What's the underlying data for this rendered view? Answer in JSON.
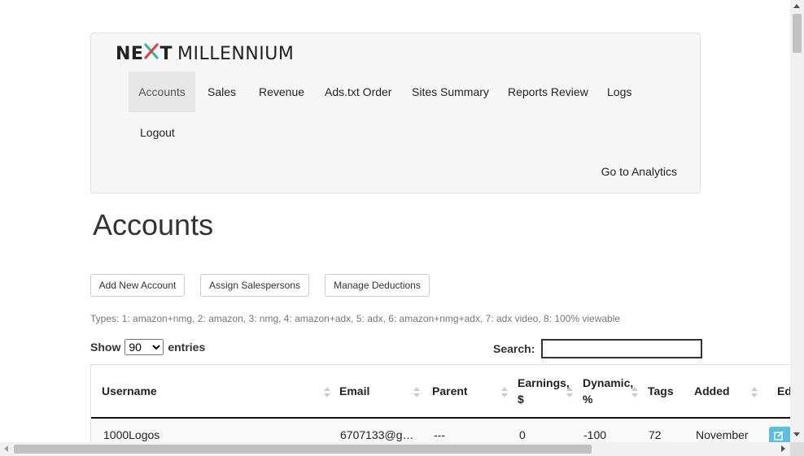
{
  "brand": {
    "part1": "NE",
    "x": "X",
    "part1b": "T",
    "part2": "MILLENNIUM",
    "x_color": "#e53b3b",
    "x_color2": "#2fb8a5"
  },
  "nav": {
    "items": [
      {
        "label": "Accounts"
      },
      {
        "label": "Sales"
      },
      {
        "label": "Revenue"
      },
      {
        "label": "Ads.txt Order"
      },
      {
        "label": "Sites Summary"
      },
      {
        "label": "Reports Review"
      },
      {
        "label": "Logs"
      },
      {
        "label": "Logout"
      }
    ],
    "goto_label": "Go to Analytics"
  },
  "page": {
    "title": "Accounts"
  },
  "actions": {
    "add_label": "Add New Account",
    "assign_label": "Assign Salespersons",
    "deductions_label": "Manage Deductions"
  },
  "types_text": "Types: 1: amazon+nmg, 2: amazon, 3: nmg, 4: amazon+adx, 5: adx, 6: amazon+nmg+adx, 7: adx video, 8: 100% viewable",
  "length": {
    "show_label": "Show",
    "selected": "90",
    "entries_label": "entries"
  },
  "search": {
    "label": "Search:",
    "value": ""
  },
  "table": {
    "columns": [
      "Username",
      "Email",
      "Parent",
      "Earnings, $",
      "Dynamic, %",
      "Tags",
      "Added",
      "Ed"
    ],
    "rows": [
      {
        "username": "1000Logos",
        "email": "6707133@g…",
        "parent": "---",
        "earnings": "0",
        "dynamic": "-100",
        "tags": "72",
        "added": "November"
      }
    ]
  },
  "colors": {
    "active_nav_bg": "#e7e7e7",
    "edit_btn": "#5bc0de"
  }
}
